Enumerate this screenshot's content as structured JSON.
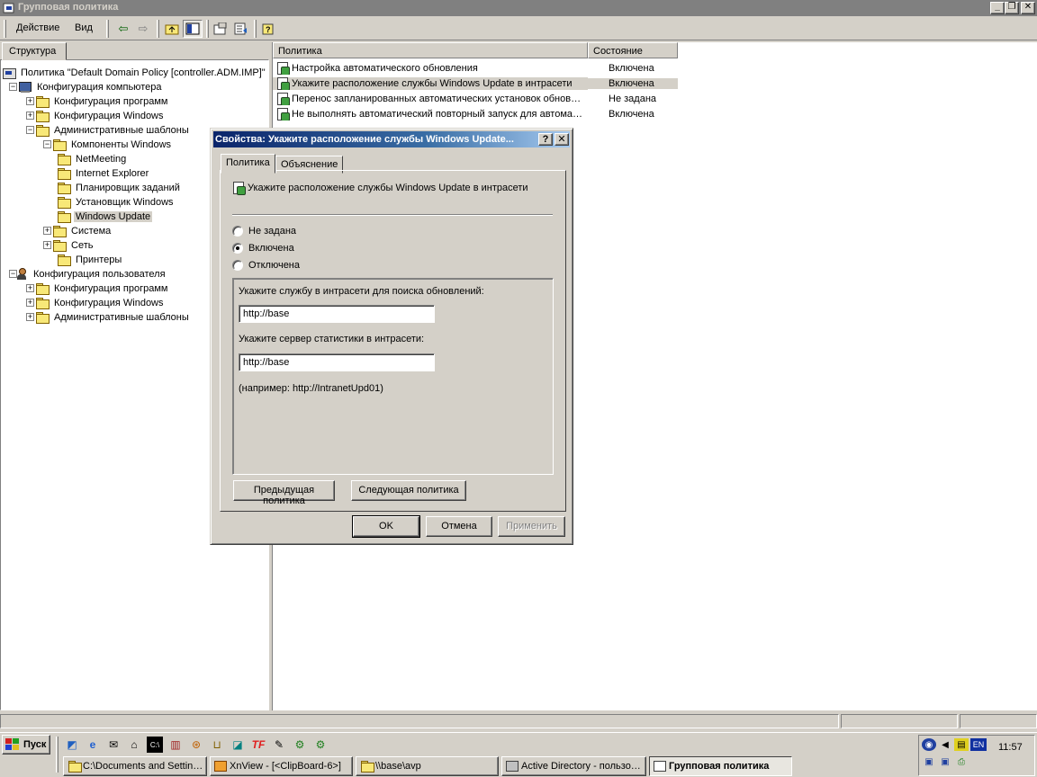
{
  "window": {
    "title": "Групповая политика",
    "controls": {
      "minimize": "_",
      "restore": "❐",
      "close": "✕"
    }
  },
  "menu": {
    "action": "Действие",
    "view": "Вид"
  },
  "left_pane": {
    "tab_label": "Структура",
    "tree": [
      {
        "label": "Политика \"Default Domain Policy [controller.ADM.IMP]\"",
        "icon": "policy-icon"
      },
      {
        "label": "Конфигурация компьютера",
        "icon": "computer-icon",
        "expander": "−"
      },
      {
        "label": "Конфигурация программ",
        "icon": "folder-icon",
        "expander": "+"
      },
      {
        "label": "Конфигурация Windows",
        "icon": "folder-icon",
        "expander": "+"
      },
      {
        "label": "Административные шаблоны",
        "icon": "folder-icon",
        "expander": "−"
      },
      {
        "label": "Компоненты Windows",
        "icon": "folder-icon",
        "expander": "−"
      },
      {
        "label": "NetMeeting",
        "icon": "folder-icon"
      },
      {
        "label": "Internet Explorer",
        "icon": "folder-icon"
      },
      {
        "label": "Планировщик заданий",
        "icon": "folder-icon"
      },
      {
        "label": "Установщик Windows",
        "icon": "folder-icon"
      },
      {
        "label": "Windows Update",
        "icon": "folder-icon",
        "selected": true
      },
      {
        "label": "Система",
        "icon": "folder-icon",
        "expander": "+"
      },
      {
        "label": "Сеть",
        "icon": "folder-icon",
        "expander": "+"
      },
      {
        "label": "Принтеры",
        "icon": "folder-icon"
      },
      {
        "label": "Конфигурация пользователя",
        "icon": "user-icon",
        "expander": "−"
      },
      {
        "label": "Конфигурация программ",
        "icon": "folder-icon",
        "expander": "+"
      },
      {
        "label": "Конфигурация Windows",
        "icon": "folder-icon",
        "expander": "+"
      },
      {
        "label": "Административные шаблоны",
        "icon": "folder-icon",
        "expander": "+"
      }
    ]
  },
  "right_pane": {
    "columns": {
      "policy": "Политика",
      "state": "Состояние"
    },
    "rows": [
      {
        "policy": "Настройка автоматического обновления",
        "state": "Включена"
      },
      {
        "policy": "Укажите расположение службы Windows Update в интрасети",
        "state": "Включена",
        "selected": true
      },
      {
        "policy": "Перенос запланированных автоматических установок обнов…",
        "state": "Не задана"
      },
      {
        "policy": "Не выполнять автоматический повторный запуск для автома…",
        "state": "Включена"
      }
    ]
  },
  "dialog": {
    "title": "Свойства: Укажите расположение службы Windows Update...",
    "help": "?",
    "close": "✕",
    "tabs": {
      "policy": "Политика",
      "explain": "Объяснение"
    },
    "policy_name": "Укажите расположение службы Windows Update в интрасети",
    "radios": {
      "not_configured": "Не задана",
      "enabled": "Включена",
      "disabled": "Отключена"
    },
    "selected_radio": "enabled",
    "options": {
      "update_service_label": "Укажите службу в интрасети для поиска обновлений:",
      "update_service_value": "http://base",
      "stats_server_label": "Укажите сервер статистики в интрасети:",
      "stats_server_value": "http://base",
      "example": "(например: http://IntranetUpd01)"
    },
    "buttons": {
      "prev": "Предыдущая политика",
      "next": "Следующая политика",
      "ok": "OK",
      "cancel": "Отмена",
      "apply": "Применить"
    }
  },
  "taskbar": {
    "start": "Пуск",
    "tasks": [
      {
        "label": "C:\\Documents and Settin…",
        "active": false
      },
      {
        "label": "XnView - [<ClipBoard-6>]",
        "active": false
      },
      {
        "label": "\\\\base\\avp",
        "active": false
      },
      {
        "label": "Active Directory - пользо…",
        "active": false
      },
      {
        "label": "Групповая политика",
        "active": true
      }
    ],
    "tray": {
      "lang": "EN",
      "clock": "11:57"
    }
  }
}
